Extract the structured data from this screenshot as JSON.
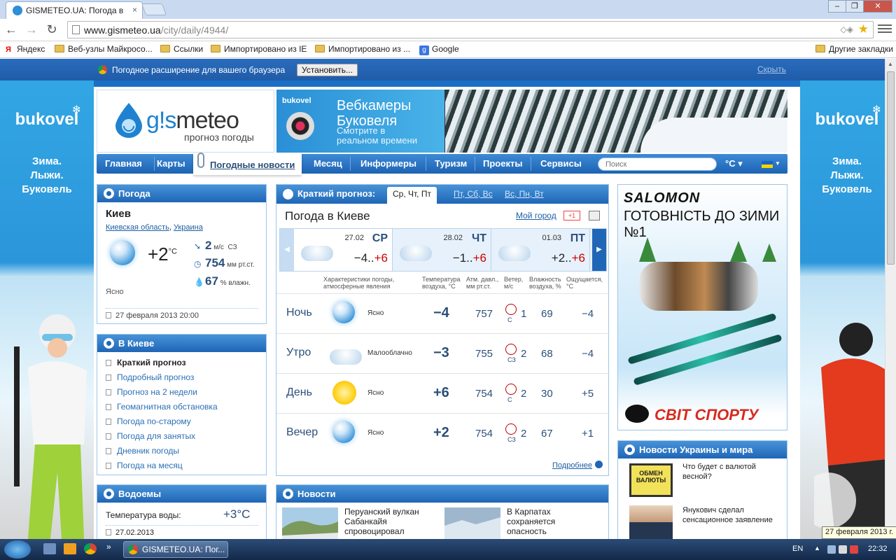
{
  "browser": {
    "tab_title": "GISMETEO.UA: Погода в Киеве",
    "tab_close": "×",
    "url_domain": "www.gismeteo.ua",
    "url_path": "/city/daily/4944/",
    "window_buttons": [
      "–",
      "❐",
      "✕"
    ],
    "bookmarks": [
      "Яндекс",
      "Веб-узлы Майкросо...",
      "Ссылки",
      "Импортировано из IE",
      "Импортировано из ...",
      "Google"
    ],
    "other_bookmarks": "Другие закладки"
  },
  "extension_bar": {
    "text": "Погодное расширение для вашего браузера",
    "install_label": "Установить...",
    "hide_label": "Скрыть"
  },
  "side_ads": {
    "logo": "bukovel",
    "slogan_1": "Зима.",
    "slogan_2": "Лыжи.",
    "slogan_3": "Буковель"
  },
  "header": {
    "logo_prefix": "g!s",
    "logo_word": "meteo",
    "logo_sub": "прогноз погоды",
    "banner_brand": "bukovel",
    "banner_title_1": "Вебкамеры",
    "banner_title_2": "Буковеля",
    "banner_sub_1": "Смотрите в",
    "banner_sub_2": "реальном времени"
  },
  "nav": {
    "items": [
      "Главная",
      "Карты",
      "Погодные новости",
      "Месяц",
      "Информеры",
      "Туризм",
      "Проекты",
      "Сервисы"
    ],
    "search_placeholder": "Поиск",
    "unit": "°C"
  },
  "current": {
    "block_title": "Погода",
    "city": "Киев",
    "region": "Киевская область",
    "country": "Украина",
    "temp": "+2",
    "temp_unit": "°C",
    "wind_value": "2",
    "wind_unit": "м/с",
    "wind_dir": "СЗ",
    "pressure_value": "754",
    "pressure_unit": "мм рт.ст.",
    "humidity_value": "67",
    "humidity_unit": "% влажн.",
    "sky": "Ясно",
    "timestamp": "27 февраля 2013 20:00"
  },
  "in_city": {
    "title": "В Киеве",
    "links": [
      "Краткий прогноз",
      "Подробный прогноз",
      "Прогноз на 2 недели",
      "Геомагнитная обстановка",
      "Погода по-старому",
      "Погода для занятых",
      "Дневник погоды",
      "Погода на месяц"
    ]
  },
  "water": {
    "title": "Водоемы",
    "label": "Температура воды:",
    "value": "+3°C",
    "date": "27.02.2013"
  },
  "forecast": {
    "title": "Краткий прогноз:",
    "tabs": [
      "Ср, Чт, Пт",
      "Пт, Сб, Вс",
      "Вс, Пн, Вт"
    ],
    "heading": "Погода в Киеве",
    "my_city": "Мой город",
    "gplus": "+1",
    "days": [
      {
        "date": "27.02",
        "wd": "СР",
        "tmin": "−4..",
        "tmax": "+6"
      },
      {
        "date": "28.02",
        "wd": "ЧТ",
        "tmin": "−1..",
        "tmax": "+6"
      },
      {
        "date": "01.03",
        "wd": "ПТ",
        "tmin": "+2..",
        "tmax": "+6"
      }
    ],
    "columns": {
      "c1a": "Характеристики погоды,",
      "c1b": "атмосферные явления",
      "c2a": "Температура",
      "c2b": "воздуха, °С",
      "c3a": "Атм. давл.,",
      "c3b": "мм рт.ст.",
      "c4a": "Ветер,",
      "c4b": "м/с",
      "c5a": "Влажность",
      "c5b": "воздуха, %",
      "c6a": "Ощущается,",
      "c6b": "°С"
    },
    "rows": [
      {
        "period": "Ночь",
        "sky": "Ясно",
        "temp": "−4",
        "pressure": "757",
        "wind_dir": "С",
        "wind": "1",
        "humidity": "69",
        "feels": "−4"
      },
      {
        "period": "Утро",
        "sky": "Малооблачно",
        "temp": "−3",
        "pressure": "755",
        "wind_dir": "СЗ",
        "wind": "2",
        "humidity": "68",
        "feels": "−4"
      },
      {
        "period": "День",
        "sky": "Ясно",
        "temp": "+6",
        "pressure": "754",
        "wind_dir": "С",
        "wind": "2",
        "humidity": "30",
        "feels": "+5"
      },
      {
        "period": "Вечер",
        "sky": "Ясно",
        "temp": "+2",
        "pressure": "754",
        "wind_dir": "СЗ",
        "wind": "2",
        "humidity": "67",
        "feels": "+1"
      }
    ],
    "more": "Подробнее"
  },
  "news": {
    "title": "Новости",
    "items": [
      {
        "text": "Перуанский вулкан Сабанкайя спровоцировал сотни"
      },
      {
        "text": "В Карпатах сохраняется опасность схождения снежных лавин"
      }
    ]
  },
  "ad_salomon": {
    "brand": "SALOMON",
    "slogan": "ГОТОВНІСТЬ ДО ЗИМИ №1",
    "shop": "СВІТ СПОРТУ",
    "sign": "ОБМЕН ВАЛЮТЫ"
  },
  "ua_news": {
    "title": "Новости Украины и мира",
    "items": [
      {
        "text": "Что будет с валютой весной?"
      },
      {
        "text": "Янукович сделал сенсационное заявление"
      }
    ]
  },
  "taskbar": {
    "window_label": "GISMETEO.UA: Пог...",
    "lang": "EN",
    "time": "22:32",
    "tooltip": "27 февраля 2013 г."
  }
}
